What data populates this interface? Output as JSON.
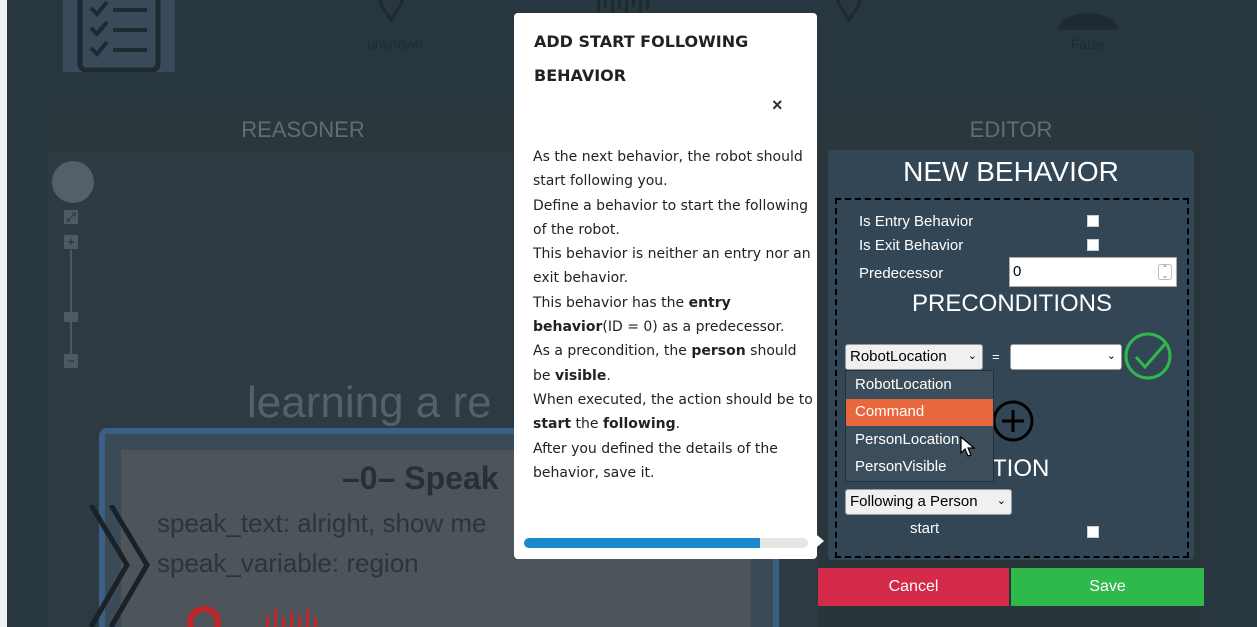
{
  "status_bar": {
    "location_value": "unknown",
    "visible_value": "False"
  },
  "reasoner": {
    "header": "REASONER",
    "overlay_text": "learning a re",
    "node_title": "–0– Speak",
    "node_lines": [
      "speak_text: alright, show me",
      "speak_variable:   region"
    ]
  },
  "editor": {
    "header": "EDITOR",
    "title": "NEW BEHAVIOR",
    "entry_label": "Is Entry Behavior",
    "exit_label": "Is Exit Behavior",
    "predecessor_label": "Predecessor",
    "predecessor_value": "0",
    "preconditions_title": "PRECONDITIONS",
    "precondition_select": "RobotLocation",
    "equals": "=",
    "precondition_value_select": "",
    "dropdown_options": [
      "RobotLocation",
      "Command",
      "PersonLocation",
      "PersonVisible"
    ],
    "dropdown_highlighted": "Command",
    "action_title": "TION",
    "action_select": "Following a Person",
    "start_label": "start",
    "cancel_label": "Cancel",
    "save_label": "Save"
  },
  "modal": {
    "title": "ADD START FOLLOWING BEHAVIOR",
    "close": "×",
    "progress": 0.83
  },
  "colors": {
    "cancel": "#d42a4a",
    "save": "#2fb94a",
    "highlight": "#e8673d",
    "progress": "#1a8acb",
    "check": "#2fb94a"
  },
  "icons": [
    "checklist-icon",
    "location-pin-icon",
    "check-circle-icon",
    "plus-circle-icon",
    "close-icon",
    "chevron-down-icon",
    "cursor-icon"
  ]
}
